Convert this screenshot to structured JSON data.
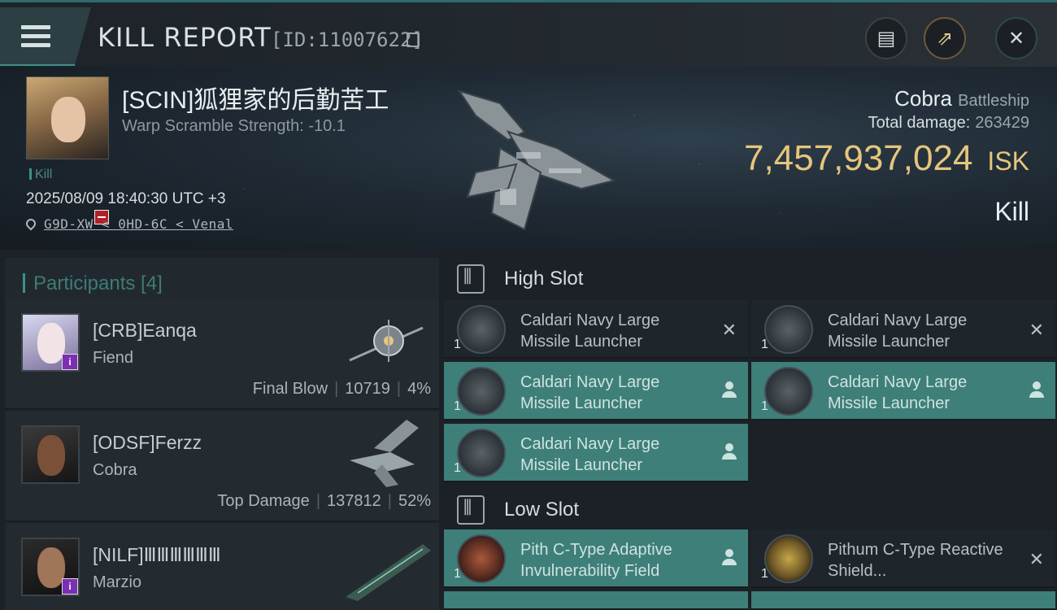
{
  "header": {
    "title": "KILL REPORT",
    "report_id": "[ID:11007622]",
    "icons": [
      "menu-icon",
      "copy-icon",
      "clipboard-icon",
      "share-icon",
      "close-icon"
    ]
  },
  "victim": {
    "name": "[SCIN]狐狸家的后勤苦工",
    "warp_scramble": "Warp Scramble Strength: -10.1",
    "tag": "Kill",
    "time": "2025/08/09 18:40:30 UTC +3",
    "location": "G9D-XW < 0HD-6C < Venal",
    "ship_name": "Cobra",
    "ship_class": "Battleship",
    "total_damage_label": "Total damage:",
    "total_damage": "263429",
    "isk_value": "7,457,937,024",
    "isk_unit": "ISK",
    "kill_type": "Kill"
  },
  "participants": {
    "title": "Participants [4]",
    "list": [
      {
        "name": "[CRB]Eanqa",
        "ship": "Fiend",
        "role": "Final Blow",
        "damage": "10719",
        "percent": "4%"
      },
      {
        "name": "[ODSF]Ferzz",
        "ship": "Cobra",
        "role": "Top Damage",
        "damage": "137812",
        "percent": "52%"
      },
      {
        "name": "[NILF]ⅢⅢⅢⅢⅢⅢ",
        "ship": "Marzio",
        "role": "",
        "damage": "",
        "percent": ""
      }
    ]
  },
  "fitting": {
    "high_slot_title": "High Slot",
    "low_slot_title": "Low Slot",
    "high_slot": [
      {
        "name": "Caldari Navy Large Missile Launcher",
        "qty": "1",
        "status": "destroyed"
      },
      {
        "name": "Caldari Navy Large Missile Launcher",
        "qty": "1",
        "status": "destroyed"
      },
      {
        "name": "Caldari Navy Large Missile Launcher",
        "qty": "1",
        "status": "dropped"
      },
      {
        "name": "Caldari Navy Large Missile Launcher",
        "qty": "1",
        "status": "dropped"
      },
      {
        "name": "Caldari Navy Large Missile Launcher",
        "qty": "1",
        "status": "dropped"
      }
    ],
    "low_slot": [
      {
        "name": "Pith C-Type Adaptive Invulnerability Field",
        "qty": "1",
        "status": "dropped"
      },
      {
        "name": "Pithum C-Type Reactive Shield...",
        "qty": "1",
        "status": "destroyed"
      }
    ]
  },
  "colors": {
    "accent_teal": "#3f8f89",
    "isk_gold": "#e6c57d",
    "dropped_bg": "#3e7f79",
    "background": "#1a1f24"
  }
}
